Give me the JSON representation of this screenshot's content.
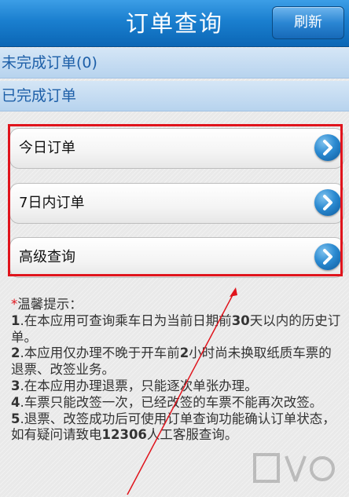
{
  "header": {
    "title": "订单查询",
    "refresh_label": "刷新"
  },
  "status_rows": {
    "pending": "未完成订单(0)",
    "done": "已完成订单"
  },
  "menu": {
    "items": [
      {
        "label": "今日订单"
      },
      {
        "label": "7日内订单"
      },
      {
        "label": "高级查询"
      }
    ]
  },
  "tips": {
    "star": "*",
    "title": "温馨提示：",
    "lines": [
      "1.在本应用可查询乘车日为当前日期前30天以内的历史订单。",
      "2.本应用仅办理不晚于开车前2小时尚未换取纸质车票的退票、改签业务。",
      "3.在本应用办理退票，只能逐次单张办理。",
      "4.车票只能改签一次，已经改签的车票不能再次改签。",
      "5.退票、改签成功后可使用订单查询功能确认订单状态，如有疑问请致电12306人工客服查询。"
    ]
  },
  "colors": {
    "accent_blue": "#1a7fcf",
    "highlight_red": "#e0141c",
    "row_text_blue": "#1d5fa8"
  },
  "icons": {
    "arrow": "chevron-right-icon"
  }
}
